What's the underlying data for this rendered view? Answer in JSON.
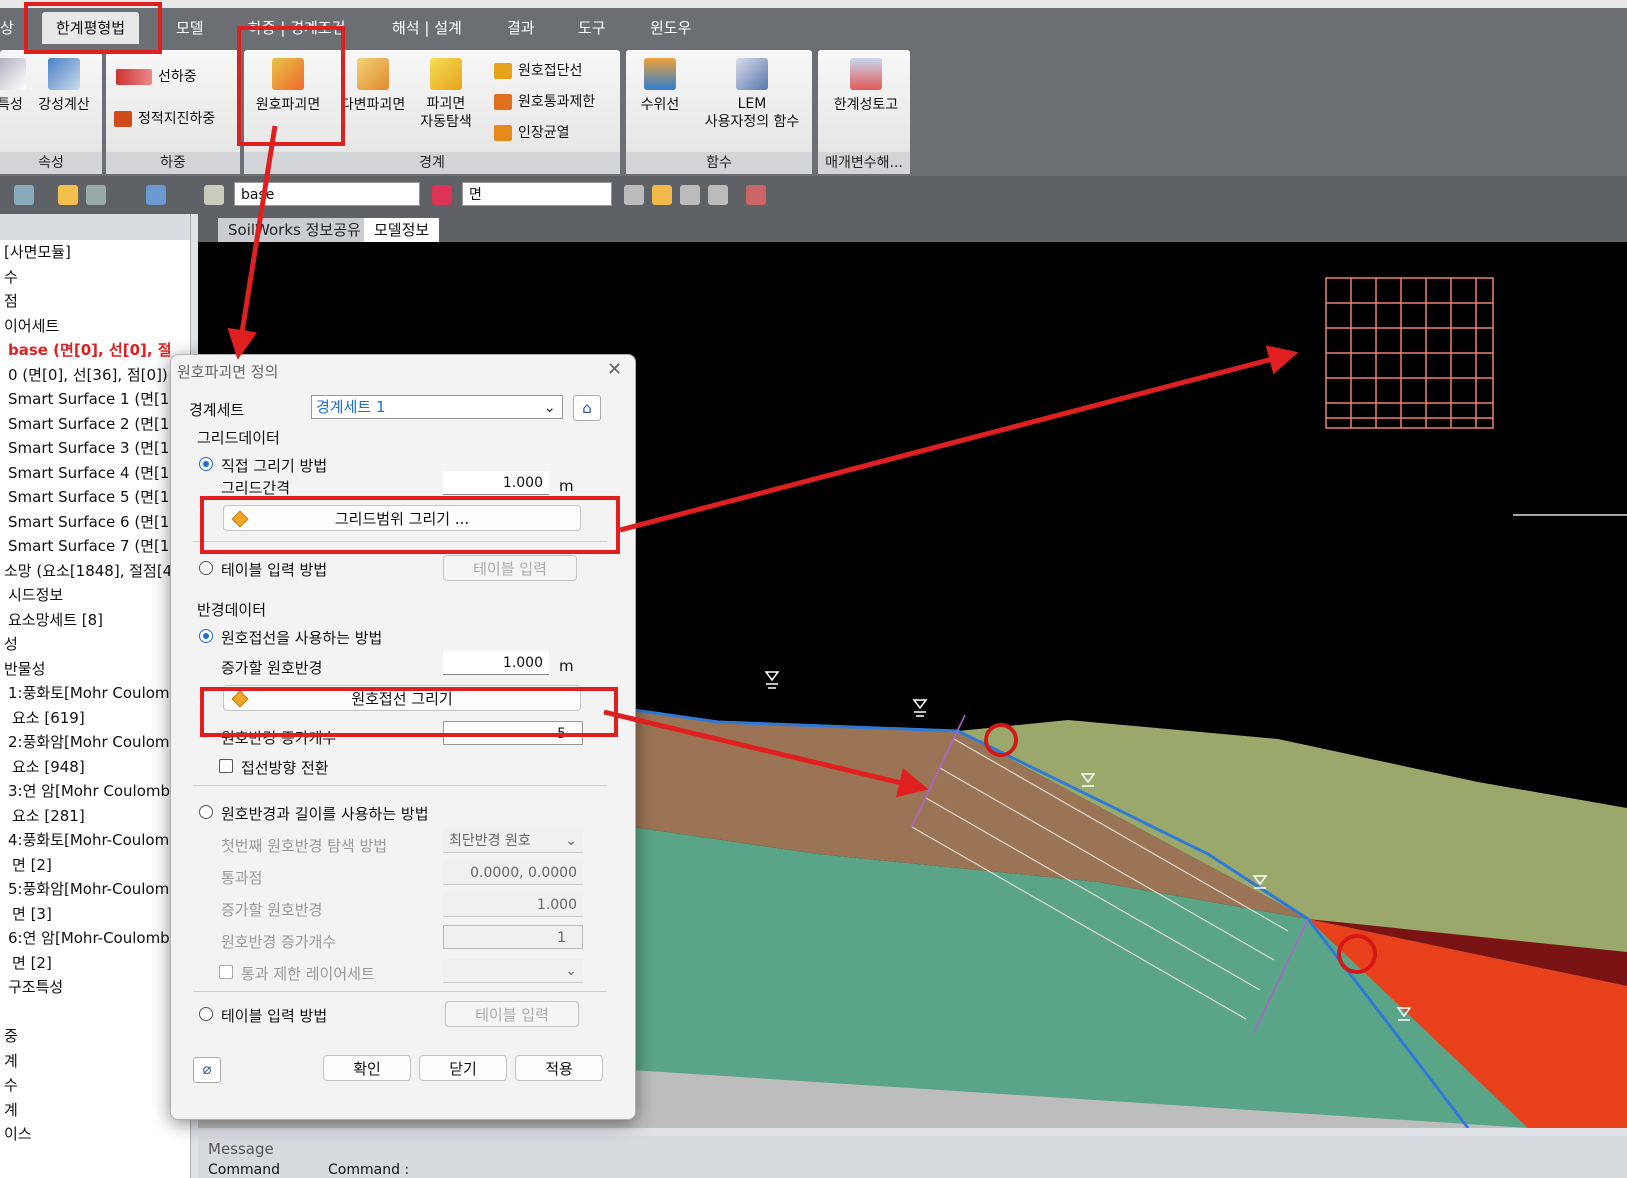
{
  "menu": {
    "tabs": [
      "상",
      "한계평형법",
      "모델",
      "하중 | 경계조건",
      "해석 | 설계",
      "결과",
      "도구",
      "윈도우"
    ],
    "active_tab": "한계평형법"
  },
  "ribbon": {
    "group_props": {
      "title": "속성",
      "btn1": "특성",
      "btn2": "강성계산"
    },
    "group_load": {
      "title": "하중",
      "btn1": "선하중",
      "btn2": "정적지진하중"
    },
    "group_boundary": {
      "title": "경계",
      "btn_circular": "원호파괴면",
      "btn_multi": "다변파괴면",
      "btn_auto_line1": "파괴면",
      "btn_auto_line2": "자동탐색",
      "btn_tangent": "원호접단선",
      "btn_pass": "원호통과제한",
      "btn_tension": "인장균열"
    },
    "group_function": {
      "title": "함수",
      "btn_water": "수위선",
      "btn_lem_line1": "LEM",
      "btn_lem_line2": "사용자정의 함수"
    },
    "group_param": {
      "title": "매개변수해...",
      "btn_limit": "한계성토고"
    }
  },
  "toolbar": {
    "layer_combo": "base",
    "face_combo": "면"
  },
  "left_panel": {
    "rows": [
      "[사면모듈]",
      "수",
      "점",
      "이어세트",
      "base (면[0], 선[0], 절",
      "0 (면[0], 선[36], 점[0])",
      "Smart Surface 1 (면[1],",
      "Smart Surface 2 (면[1],",
      "Smart Surface 3 (면[1],",
      "Smart Surface 4 (면[1],",
      "Smart Surface 5 (면[1],",
      "Smart Surface 6 (면[1],",
      "Smart Surface 7 (면[1],",
      "소망 (요소[1848], 절점[4",
      "시드정보",
      "요소망세트 [8]",
      "성",
      "반물성",
      "1:풍화토[Mohr Coulom",
      "요소 [619]",
      "2:풍화암[Mohr Coulom",
      "요소 [948]",
      "3:연 암[Mohr Coulomb]",
      "요소 [281]",
      "4:풍화토[Mohr-Coulom",
      "면 [2]",
      "5:풍화암[Mohr-Coulom",
      "면 [3]",
      "6:연 암[Mohr-Coulomb",
      "면 [2]",
      "구조특성",
      "",
      "중",
      "계",
      "수",
      "계",
      "이스"
    ]
  },
  "doc_tabs": [
    "SoilWorks 정보공유",
    "모델정보"
  ],
  "dialog": {
    "title": "원호파괴면 정의",
    "boundary_set_label": "경계세트",
    "boundary_set_value": "경계세트 1",
    "grid_section": "그리드데이터",
    "grid_direct": "직접 그리기 방법",
    "grid_spacing_label": "그리드간격",
    "grid_spacing_value": "1.000",
    "unit_m": "m",
    "grid_draw_button": "그리드범위 그리기 ...",
    "table_method": "테이블 입력 방법",
    "table_input_button": "테이블 입력",
    "radius_section": "반경데이터",
    "tangent_method": "원호접선을 사용하는 방법",
    "increase_radius_label": "증가할 원호반경",
    "increase_radius_value": "1.000",
    "tangent_draw_button": "원호접선 그리기",
    "radius_count_label": "원호반경 증가개수",
    "radius_count_value": "5",
    "tangent_flip": "접선방향 전환",
    "radius_length_method": "원호반경과 길이를 사용하는 방법",
    "first_radius_label": "첫번째 원호반경 탐색 방법",
    "first_radius_value": "최단반경 원호",
    "pass_point_label": "통과점",
    "pass_point_value": "0.0000, 0.0000",
    "increase_radius2_label": "증가할 원호반경",
    "increase_radius2_value": "1.000",
    "radius_count2_label": "원호반경 증가개수",
    "radius_count2_value": "1",
    "pass_limit_layer": "통과 제한 레이어세트",
    "table_method2": "테이블 입력 방법",
    "table_input_button2": "테이블 입력",
    "ok": "확인",
    "close": "닫기",
    "apply": "적용"
  },
  "message": {
    "title": "Message",
    "col1": "Command",
    "col2": "Command :"
  },
  "colors": {
    "annotation_red": "#e02020",
    "soil_brown": "#9b7456",
    "soil_olive": "#9aa96b",
    "soil_green": "#5aa587",
    "soil_darkred": "#7a1414",
    "soil_orange": "#e8401a",
    "slope_blue": "#2f7ad8"
  }
}
